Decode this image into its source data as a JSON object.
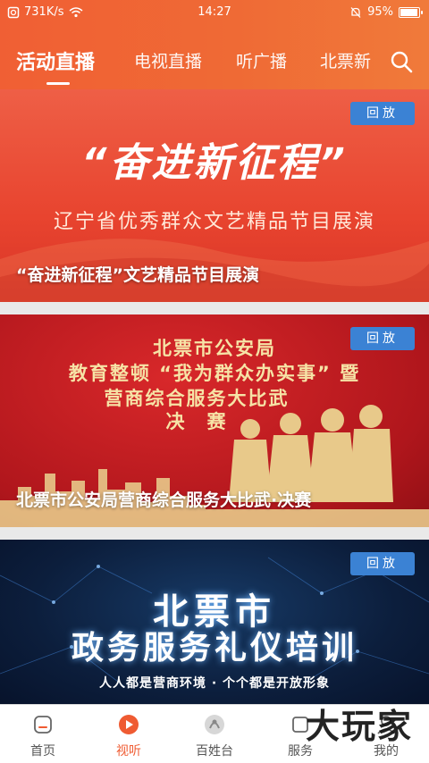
{
  "status_bar": {
    "speed": "731K/s",
    "time": "14:27",
    "battery": "95%",
    "battery_level": 0.95
  },
  "tabs": [
    {
      "label": "活动直播",
      "active": true
    },
    {
      "label": "电视直播",
      "active": false
    },
    {
      "label": "听广播",
      "active": false
    },
    {
      "label": "北票新",
      "active": false
    }
  ],
  "icons": {
    "search": "search-icon",
    "wifi": "wifi-icon",
    "battery": "battery-icon"
  },
  "cards": [
    {
      "badge": "回放",
      "poster_title": "“奋进新征程”",
      "poster_subtitle": "辽宁省优秀群众文艺精品节目展演",
      "caption": "“奋进新征程”文艺精品节目展演"
    },
    {
      "badge": "回放",
      "poster_lines": [
        "北票市公安局",
        "教育整顿 “我为群众办实事” 暨",
        "营商综合服务大比武",
        "决　赛"
      ],
      "caption": "北票市公安局营商综合服务大比武·决赛"
    },
    {
      "badge": "回放",
      "poster_title": "北票市",
      "poster_title2": "政务服务礼仪培训",
      "poster_slogan": "人人都是营商环境 · 个个都是开放形象"
    }
  ],
  "bottom_nav": [
    {
      "label": "首页",
      "icon": "home-icon",
      "active": false
    },
    {
      "label": "视听",
      "icon": "play-icon",
      "active": true
    },
    {
      "label": "百姓台",
      "icon": "people-icon",
      "active": false
    },
    {
      "label": "服务",
      "icon": "service-icon",
      "active": false
    },
    {
      "label": "我的",
      "icon": "profile-icon",
      "active": false
    }
  ],
  "watermark": "大玩家",
  "colors": {
    "accent": "#ef5b32",
    "badge": "#3b82d4"
  }
}
